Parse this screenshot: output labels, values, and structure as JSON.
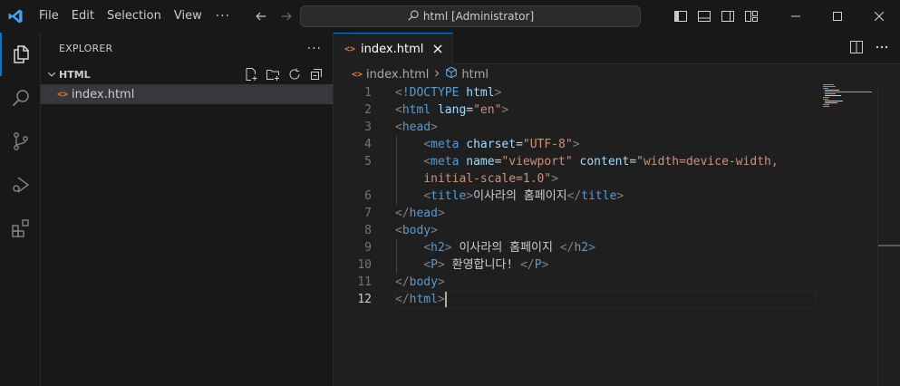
{
  "titlebar": {
    "menu": [
      "File",
      "Edit",
      "Selection",
      "View"
    ],
    "more": "···",
    "command_center": "html [Administrator]"
  },
  "sidebar": {
    "title": "EXPLORER",
    "more": "···",
    "folder": "HTML",
    "files": [
      {
        "name": "index.html",
        "icon": "<>"
      }
    ]
  },
  "editor": {
    "tab": {
      "label": "index.html",
      "icon": "<>"
    },
    "breadcrumb": {
      "file": "index.html",
      "symbol": "html",
      "icon": "<>"
    },
    "current_line": 12,
    "lines": [
      {
        "num": "1",
        "indent": 0,
        "tokens": [
          [
            "b",
            "<"
          ],
          [
            "t",
            "!DOCTYPE"
          ],
          [
            "x",
            " "
          ],
          [
            "a",
            "html"
          ],
          [
            "b",
            ">"
          ]
        ]
      },
      {
        "num": "2",
        "indent": 0,
        "tokens": [
          [
            "b",
            "<"
          ],
          [
            "t",
            "html"
          ],
          [
            "x",
            " "
          ],
          [
            "a",
            "lang"
          ],
          [
            "x",
            "="
          ],
          [
            "s",
            "\"en\""
          ],
          [
            "b",
            ">"
          ]
        ]
      },
      {
        "num": "3",
        "indent": 0,
        "tokens": [
          [
            "b",
            "<"
          ],
          [
            "t",
            "head"
          ],
          [
            "b",
            ">"
          ]
        ]
      },
      {
        "num": "4",
        "indent": 1,
        "tokens": [
          [
            "b",
            "<"
          ],
          [
            "t",
            "meta"
          ],
          [
            "x",
            " "
          ],
          [
            "a",
            "charset"
          ],
          [
            "x",
            "="
          ],
          [
            "s",
            "\"UTF-8\""
          ],
          [
            "b",
            ">"
          ]
        ]
      },
      {
        "num": "5",
        "indent": 1,
        "tokens": [
          [
            "b",
            "<"
          ],
          [
            "t",
            "meta"
          ],
          [
            "x",
            " "
          ],
          [
            "a",
            "name"
          ],
          [
            "x",
            "="
          ],
          [
            "s",
            "\"viewport\""
          ],
          [
            "x",
            " "
          ],
          [
            "a",
            "content"
          ],
          [
            "x",
            "="
          ],
          [
            "s",
            "\"width=device-width,"
          ]
        ]
      },
      {
        "num": "",
        "indent": 1,
        "tokens": [
          [
            "s",
            "initial-scale=1.0\""
          ],
          [
            "b",
            ">"
          ]
        ]
      },
      {
        "num": "6",
        "indent": 1,
        "tokens": [
          [
            "b",
            "<"
          ],
          [
            "t",
            "title"
          ],
          [
            "b",
            ">"
          ],
          [
            "x",
            "이사라의 홈페이지"
          ],
          [
            "b",
            "</"
          ],
          [
            "t",
            "title"
          ],
          [
            "b",
            ">"
          ]
        ]
      },
      {
        "num": "7",
        "indent": 0,
        "tokens": [
          [
            "b",
            "</"
          ],
          [
            "t",
            "head"
          ],
          [
            "b",
            ">"
          ]
        ]
      },
      {
        "num": "8",
        "indent": 0,
        "tokens": [
          [
            "b",
            "<"
          ],
          [
            "t",
            "body"
          ],
          [
            "b",
            ">"
          ]
        ]
      },
      {
        "num": "9",
        "indent": 1,
        "tokens": [
          [
            "b",
            "<"
          ],
          [
            "t",
            "h2"
          ],
          [
            "b",
            ">"
          ],
          [
            "x",
            " 이사라의 홈페이지 "
          ],
          [
            "b",
            "</"
          ],
          [
            "t",
            "h2"
          ],
          [
            "b",
            ">"
          ]
        ]
      },
      {
        "num": "10",
        "indent": 1,
        "tokens": [
          [
            "b",
            "<"
          ],
          [
            "t",
            "P"
          ],
          [
            "b",
            ">"
          ],
          [
            "x",
            " 환영합니다! "
          ],
          [
            "b",
            "</"
          ],
          [
            "t",
            "P"
          ],
          [
            "b",
            ">"
          ]
        ]
      },
      {
        "num": "11",
        "indent": 0,
        "tokens": [
          [
            "b",
            "</"
          ],
          [
            "t",
            "body"
          ],
          [
            "b",
            ">"
          ]
        ]
      },
      {
        "num": "12",
        "indent": 0,
        "tokens": [
          [
            "b",
            "</"
          ],
          [
            "t",
            "html"
          ],
          [
            "b",
            ">"
          ]
        ]
      }
    ]
  },
  "colors": {
    "accent": "#0078d4",
    "tag": "#569cd6",
    "attr": "#9cdcfe",
    "string": "#ce9178",
    "bracket": "#808080",
    "html_icon": "#e37933"
  }
}
